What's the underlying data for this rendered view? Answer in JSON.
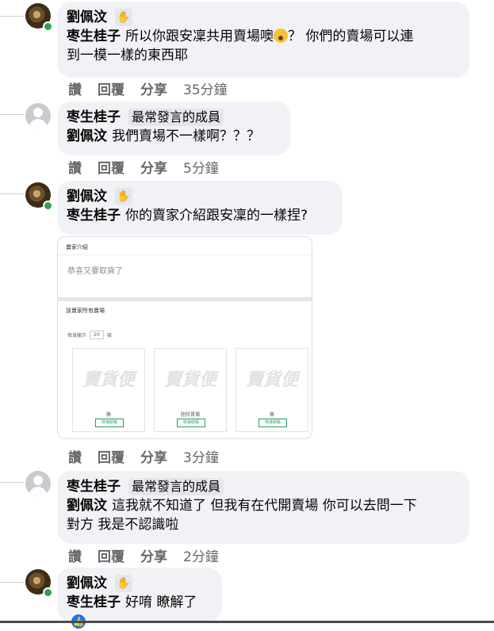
{
  "actions": {
    "like": "讚",
    "reply": "回覆",
    "share": "分享"
  },
  "comments": [
    {
      "author": "劉佩汶",
      "mention": "枣生桂子",
      "text_line1": "所以你跟安凜共用賣場噢",
      "text_line1_after": "？ 你們的賣場可以連",
      "text_line2": "到一模一樣的東西耶",
      "time": "35分鐘",
      "emoji": "hushed-face-emoji"
    },
    {
      "author": "枣生桂子",
      "badge": "最常發言的成員",
      "mention": "劉佩汶",
      "text": "我們賣場不一樣啊？？？",
      "time": "5分鐘"
    },
    {
      "author": "劉佩汶",
      "mention": "枣生桂子",
      "text": "你的賣家介紹跟安凜的一樣捏?",
      "time": "3分鐘",
      "attachment": {
        "section1_title": "賣家介紹",
        "intro_text": "恭喜又要取貨了",
        "section2_title": "該賣家所有賣場",
        "per_page_label": "每頁顯示",
        "per_page_value": "20",
        "per_page_unit": "項",
        "logo_text": "賣貨便",
        "stores": [
          {
            "name": "無",
            "button": "快速結帳"
          },
          {
            "name": "陸防賣場",
            "button": "快速結帳"
          },
          {
            "name": "無",
            "button": "快速結帳"
          }
        ]
      }
    },
    {
      "author": "枣生桂子",
      "badge": "最常發言的成員",
      "mention": "劉佩汶",
      "text_line1": "這我就不知道了 但我有在代開賣場 你可以去問一下",
      "text_line2": "對方 我是不認識啦",
      "time": "2分鐘"
    },
    {
      "author": "劉佩汶",
      "mention": "枣生桂子",
      "text": "好唷 瞭解了",
      "reaction": "like-icon"
    }
  ],
  "colors": {
    "bubble": "#f0f2f5",
    "meta": "#65676b",
    "online": "#31a24c",
    "like": "#1877f2"
  }
}
